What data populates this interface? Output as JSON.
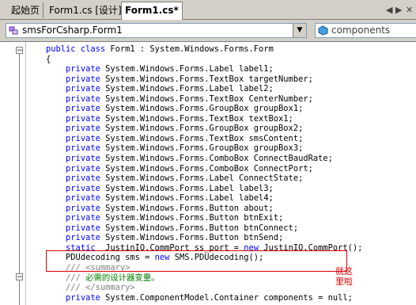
{
  "tabs": [
    {
      "label": "起始页",
      "active": false
    },
    {
      "label": "Form1.cs [设计]*",
      "active": false
    },
    {
      "label": "Form1.cs*",
      "active": true
    }
  ],
  "tab_controls": {
    "left_arrow": "◀",
    "right_arrow": "▶",
    "close": "✕"
  },
  "class_combo": {
    "value": "smsForCsharp.Form1"
  },
  "member_combo": {
    "value": "components"
  },
  "code_lines": [
    {
      "text": "    public class Form1 : System.Windows.Forms.Form",
      "kind": "class"
    },
    {
      "text": "    {",
      "kind": "plain"
    },
    {
      "text": "        private System.Windows.Forms.Label label1;",
      "kind": "private"
    },
    {
      "text": "        private System.Windows.Forms.TextBox targetNumber;",
      "kind": "private"
    },
    {
      "text": "        private System.Windows.Forms.Label label2;",
      "kind": "private"
    },
    {
      "text": "        private System.Windows.Forms.TextBox CenterNumber;",
      "kind": "private"
    },
    {
      "text": "        private System.Windows.Forms.GroupBox groupBox1;",
      "kind": "private"
    },
    {
      "text": "        private System.Windows.Forms.TextBox textBox1;",
      "kind": "private"
    },
    {
      "text": "        private System.Windows.Forms.GroupBox groupBox2;",
      "kind": "private"
    },
    {
      "text": "        private System.Windows.Forms.TextBox smsContent;",
      "kind": "private"
    },
    {
      "text": "        private System.Windows.Forms.GroupBox groupBox3;",
      "kind": "private"
    },
    {
      "text": "        private System.Windows.Forms.ComboBox ConnectBaudRate;",
      "kind": "private"
    },
    {
      "text": "        private System.Windows.Forms.ComboBox ConnectPort;",
      "kind": "private"
    },
    {
      "text": "        private System.Windows.Forms.Label ConnectState;",
      "kind": "private"
    },
    {
      "text": "        private System.Windows.Forms.Label label3;",
      "kind": "private"
    },
    {
      "text": "        private System.Windows.Forms.Label label4;",
      "kind": "private"
    },
    {
      "text": "        private System.Windows.Forms.Button about;",
      "kind": "private"
    },
    {
      "text": "        private System.Windows.Forms.Button btnExit;",
      "kind": "private"
    },
    {
      "text": "        private System.Windows.Forms.Button btnConnect;",
      "kind": "private"
    },
    {
      "text": "        private System.Windows.Forms.Button btnSend;",
      "kind": "private"
    },
    {
      "text": "        static  JustinIO.CommPort ss_port = new JustinIO.CommPort();",
      "kind": "static"
    },
    {
      "text": "        PDUdecoding sms = new SMS.PDUdecoding();",
      "kind": "new"
    },
    {
      "text": "        /// <summary>",
      "kind": "doc-tag"
    },
    {
      "text": "        /// 必需的设计器变量。",
      "kind": "doc"
    },
    {
      "text": "        /// </summary>",
      "kind": "doc-tag"
    },
    {
      "text": "        private System.ComponentModel.Container components = null;",
      "kind": "private"
    }
  ],
  "annotation": {
    "text": "就这里啦",
    "color": "#e00000"
  },
  "colors": {
    "keyword": "#0000ff",
    "comment": "#008000",
    "comment_tag": "#808080",
    "highlight": "#e00000"
  }
}
